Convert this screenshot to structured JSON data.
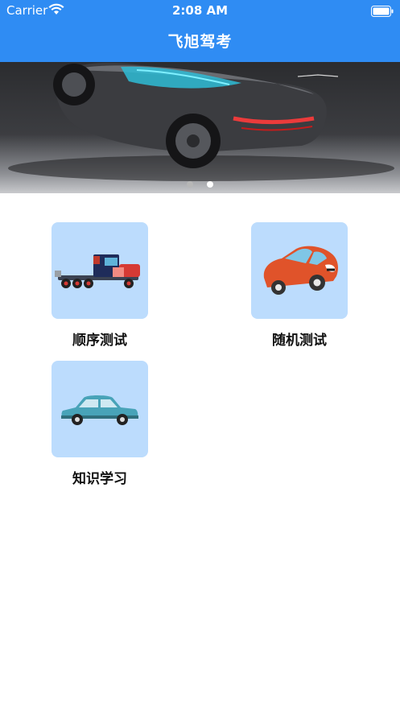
{
  "status_bar": {
    "carrier": "Carrier",
    "time": "2:08 AM"
  },
  "nav": {
    "title": "飞旭驾考"
  },
  "banner": {
    "pages": 2,
    "active_page": 2
  },
  "menu": {
    "items": [
      {
        "label": "顺序测试",
        "icon": "truck-icon"
      },
      {
        "label": "随机测试",
        "icon": "red-car-icon"
      },
      {
        "label": "知识学习",
        "icon": "sedan-icon"
      }
    ]
  },
  "colors": {
    "nav_background": "#2f8cf3",
    "tile_background": "#bcdcfd",
    "dot_active": "#ffffff",
    "dot_inactive": "#b7b7b7"
  }
}
